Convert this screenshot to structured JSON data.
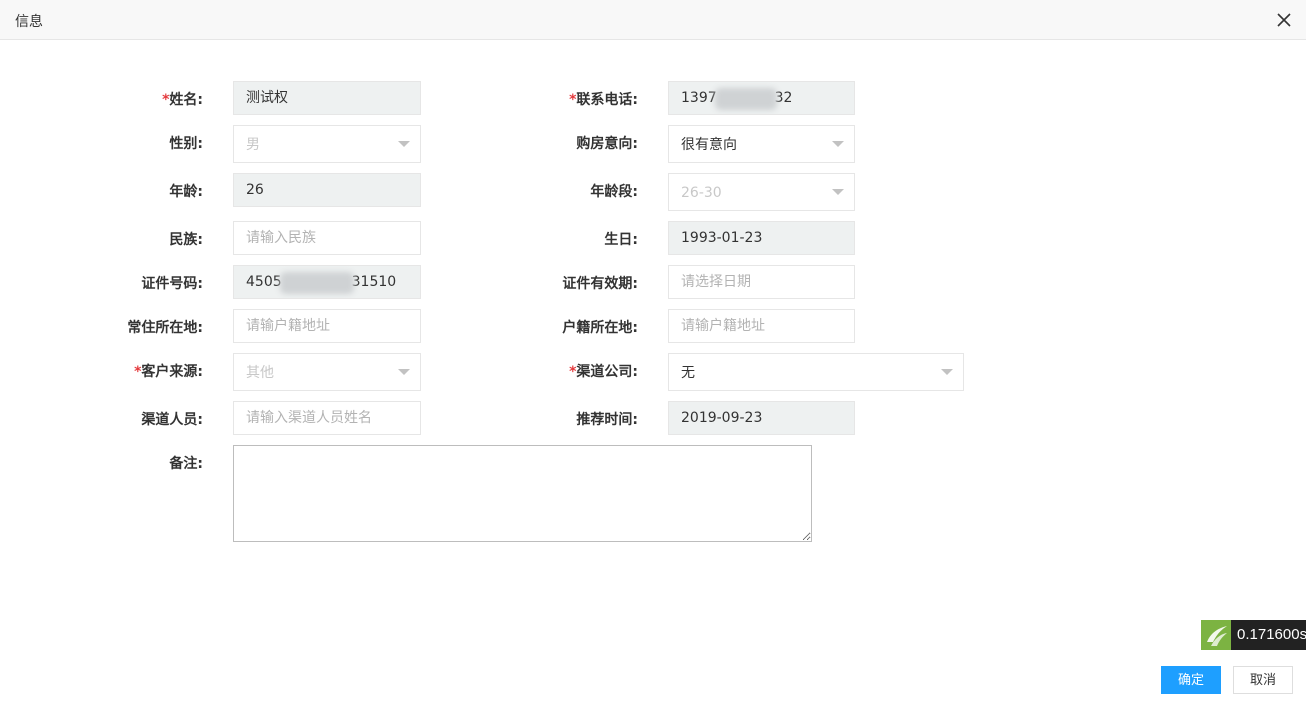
{
  "dialog": {
    "title": "信息"
  },
  "form": {
    "name": {
      "label": "姓名:",
      "value": "测试权"
    },
    "phone": {
      "label": "联系电话:",
      "value_start": "1397",
      "value_end": "32"
    },
    "gender": {
      "label": "性别:",
      "value": "男"
    },
    "purchase_intent": {
      "label": "购房意向:",
      "value": "很有意向"
    },
    "age": {
      "label": "年龄:",
      "value": "26"
    },
    "age_group": {
      "label": "年龄段:",
      "value": "26-30"
    },
    "ethnicity": {
      "label": "民族:",
      "placeholder": "请输入民族"
    },
    "birthday": {
      "label": "生日:",
      "value": "1993-01-23"
    },
    "id_number": {
      "label": "证件号码:",
      "value_start": "4505",
      "value_end": "31510"
    },
    "id_validity": {
      "label": "证件有效期:",
      "placeholder": "请选择日期"
    },
    "residence": {
      "label": "常住所在地:",
      "placeholder": "请输户籍地址"
    },
    "household": {
      "label": "户籍所在地:",
      "placeholder": "请输户籍地址"
    },
    "customer_source": {
      "label": "客户来源:",
      "value": "其他"
    },
    "channel_company": {
      "label": "渠道公司:",
      "value": "无"
    },
    "channel_staff": {
      "label": "渠道人员:",
      "placeholder": "请输入渠道人员姓名"
    },
    "referral_time": {
      "label": "推荐时间:",
      "value": "2019-09-23"
    },
    "remark": {
      "label": "备注:",
      "value": ""
    },
    "required_mark": "*"
  },
  "timer": {
    "value": "0.171600s"
  },
  "buttons": {
    "confirm": "确定",
    "cancel": "取消"
  },
  "colors": {
    "primary": "#1e9fff",
    "required": "#e4393c",
    "readonly_bg": "#eef1f1"
  }
}
